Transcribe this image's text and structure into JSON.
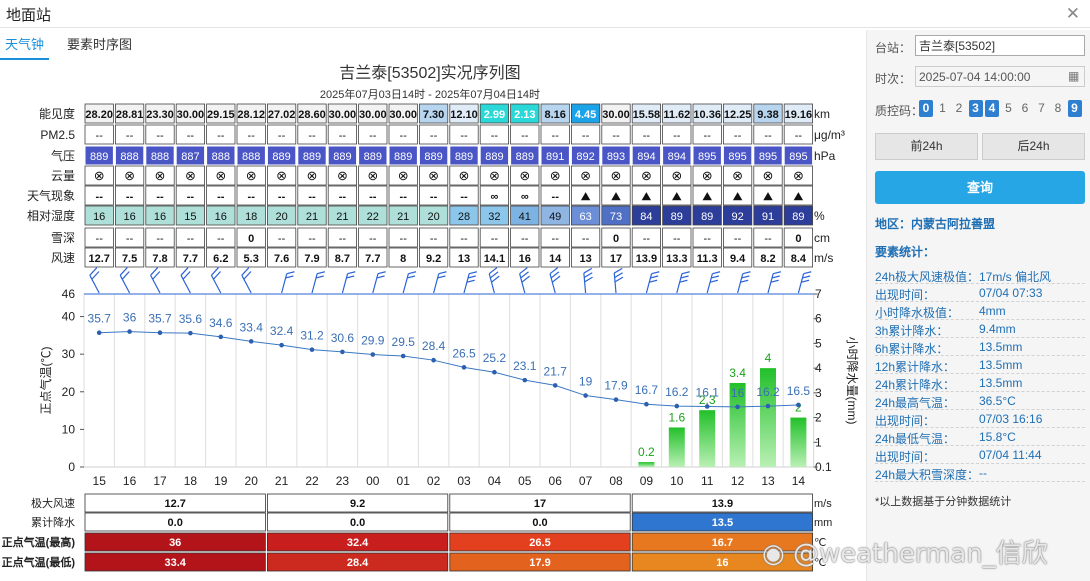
{
  "window": {
    "title": "地面站",
    "close_icon": "close-icon"
  },
  "tabs": [
    "天气钟",
    "要素时序图"
  ],
  "chart": {
    "title": "吉兰泰[53502]实况序列图",
    "subtitle": "2025年07月03日14时 - 2025年07月04日14时",
    "row_labels": [
      "能见度",
      "PM2.5",
      "气压",
      "云量",
      "天气现象",
      "相对湿度",
      "雪深",
      "风速"
    ],
    "row_units": [
      "km",
      "μg/m³",
      "hPa",
      "",
      "",
      "%",
      "cm",
      "m/s"
    ],
    "visibility": [
      "28.20",
      "28.81",
      "23.30",
      "30.00",
      "29.15",
      "28.12",
      "27.02",
      "28.60",
      "30.00",
      "30.00",
      "30.00",
      "7.30",
      "12.10",
      "2.99",
      "2.13",
      "8.16",
      "4.45",
      "30.00",
      "15.58",
      "11.62",
      "10.36",
      "12.25",
      "9.38",
      "19.16"
    ],
    "pm25": [
      "--",
      "--",
      "--",
      "--",
      "--",
      "--",
      "--",
      "--",
      "--",
      "--",
      "--",
      "--",
      "--",
      "--",
      "--",
      "--",
      "--",
      "--",
      "--",
      "--",
      "--",
      "--",
      "--",
      "--"
    ],
    "pressure": [
      "889",
      "888",
      "888",
      "887",
      "888",
      "888",
      "889",
      "889",
      "889",
      "889",
      "889",
      "889",
      "889",
      "889",
      "889",
      "891",
      "892",
      "893",
      "894",
      "894",
      "895",
      "895",
      "895",
      "895"
    ],
    "cloud_symbol": "⊗",
    "weather": [
      "--",
      "--",
      "--",
      "--",
      "--",
      "--",
      "--",
      "--",
      "--",
      "--",
      "--",
      "--",
      "--",
      "∞",
      "∞",
      "--",
      "⛰",
      "⛰",
      "⛰",
      "⛰",
      "⛰",
      "⛰",
      "⛰",
      "⛰"
    ],
    "humidity": [
      "16",
      "16",
      "16",
      "15",
      "16",
      "18",
      "20",
      "21",
      "21",
      "22",
      "21",
      "20",
      "28",
      "32",
      "41",
      "49",
      "63",
      "73",
      "84",
      "89",
      "89",
      "92",
      "91",
      "89"
    ],
    "snow": [
      "--",
      "--",
      "--",
      "--",
      "--",
      "0",
      "--",
      "--",
      "--",
      "--",
      "--",
      "--",
      "--",
      "--",
      "--",
      "--",
      "--",
      "0",
      "--",
      "--",
      "--",
      "--",
      "--",
      "0"
    ],
    "wind_speed": [
      "12.7",
      "7.5",
      "7.8",
      "7.7",
      "6.2",
      "5.3",
      "7.6",
      "7.9",
      "8.7",
      "7.7",
      "8",
      "9.2",
      "13",
      "14.1",
      "16",
      "14",
      "13",
      "17",
      "13.9",
      "13.3",
      "11.3",
      "9.4",
      "8.2",
      "8.4"
    ],
    "y_left_label": "正点气温(℃)",
    "y_right_label": "小时降水量(mm)",
    "y_left_top_tick": "46",
    "y_right_ticks": [
      "7",
      "6",
      "5",
      "4",
      "3",
      "2",
      "1",
      "0.1"
    ],
    "bottom_rows": [
      {
        "label": "极大风速",
        "unit": "m/s",
        "values": [
          "12.7",
          "9.2",
          "17",
          "13.9"
        ]
      },
      {
        "label": "累计降水",
        "unit": "mm",
        "values": [
          "0.0",
          "0.0",
          "0.0",
          "13.5"
        ]
      },
      {
        "label": "正点气温(最高)",
        "unit": "℃",
        "values": [
          "36",
          "32.4",
          "26.5",
          "16.7"
        ]
      },
      {
        "label": "正点气温(最低)",
        "unit": "℃",
        "values": [
          "33.4",
          "28.4",
          "17.9",
          "16"
        ]
      }
    ]
  },
  "chart_data": {
    "type": "line",
    "x": [
      "15",
      "16",
      "17",
      "18",
      "19",
      "20",
      "21",
      "22",
      "23",
      "00",
      "01",
      "02",
      "03",
      "04",
      "05",
      "06",
      "07",
      "08",
      "09",
      "10",
      "11",
      "12",
      "13",
      "14"
    ],
    "ylim": [
      0,
      46
    ],
    "y_ticks": [
      0,
      10,
      20,
      30,
      40
    ],
    "series": [
      {
        "values": [
          35.7,
          36,
          35.7,
          35.6,
          34.6,
          33.4,
          32.4,
          31.2,
          30.6,
          29.9,
          29.5,
          28.4,
          26.5,
          25.2,
          23.1,
          21.7,
          19,
          17.9,
          16.7,
          16.2,
          16.1,
          16,
          16.2,
          16.5
        ],
        "color": "#3a78c4"
      },
      {
        "type": "bar",
        "values": [
          null,
          null,
          null,
          null,
          null,
          null,
          null,
          null,
          null,
          null,
          null,
          null,
          null,
          null,
          null,
          null,
          null,
          null,
          0.2,
          1.6,
          2.3,
          3.4,
          4,
          2
        ],
        "color": "#33cc33",
        "axis": "right",
        "ylim": [
          0,
          7
        ]
      }
    ]
  },
  "side": {
    "station_label": "台站：",
    "station_value": "吉兰泰[53502]",
    "time_label": "时次：",
    "time_value": "2025-07-04 14:00:00",
    "qc_label": "质控码：",
    "qc_codes": [
      "0",
      "1",
      "2",
      "3",
      "4",
      "5",
      "6",
      "7",
      "8",
      "9"
    ],
    "prev_label": "前24h",
    "next_label": "后24h",
    "query_label": "查询",
    "area": "地区：内蒙古阿拉善盟",
    "stats_title": "要素统计：",
    "stats": [
      [
        "24h极大风速极值：",
        "17m/s 偏北风"
      ],
      [
        "出现时间：",
        "07/04 07:33"
      ],
      [
        "小时降水极值：",
        "4mm"
      ],
      [
        "3h累计降水：",
        "9.4mm"
      ],
      [
        "6h累计降水：",
        "13.5mm"
      ],
      [
        "12h累计降水：",
        "13.5mm"
      ],
      [
        "24h累计降水：",
        "13.5mm"
      ],
      [
        "24h最高气温：",
        "36.5°C"
      ],
      [
        "出现时间：",
        "07/03 16:16"
      ],
      [
        "24h最低气温：",
        "15.8°C"
      ],
      [
        "出现时间：",
        "07/04 11:44"
      ],
      [
        "24h最大积雪深度：",
        "--"
      ]
    ],
    "note": "*以上数据基于分钟数据统计"
  },
  "watermark": "@weatherman_信欣"
}
